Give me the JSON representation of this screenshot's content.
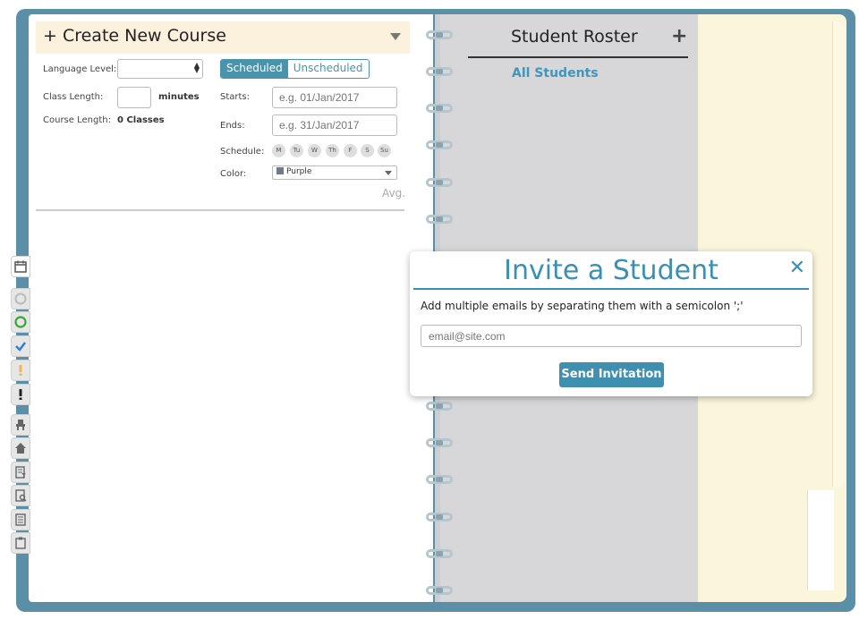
{
  "course": {
    "header_title": "+ Create New Course",
    "language_level_label": "Language Level:",
    "class_length_label": "Class Length:",
    "class_length_unit": "minutes",
    "course_length_label": "Course Length:",
    "course_length_value": "0 Classes",
    "toggle": {
      "scheduled": "Scheduled",
      "unscheduled": "Unscheduled",
      "selected": "Scheduled"
    },
    "starts_label": "Starts:",
    "starts_placeholder": "e.g. 01/Jan/2017",
    "ends_label": "Ends:",
    "ends_placeholder": "e.g. 31/Jan/2017",
    "schedule_label": "Schedule:",
    "days": [
      "M",
      "Tu",
      "W",
      "Th",
      "F",
      "S",
      "Su"
    ],
    "color_label": "Color:",
    "color_value": "Purple",
    "avg_label": "Avg."
  },
  "roster": {
    "title": "Student Roster",
    "add_symbol": "+",
    "all_students": "All Students"
  },
  "modal": {
    "title": "Invite a Student",
    "close_symbol": "✕",
    "instructions": "Add multiple emails by separating them with a semicolon ';'",
    "email_placeholder": "email@site.com",
    "send_label": "Send Invitation"
  },
  "side_tabs": [
    "calendar-icon",
    "circle-grey-icon",
    "circle-green-icon",
    "checkmark-icon",
    "exclamation-orange-icon",
    "exclamation-black-icon",
    "chair-icon",
    "home-icon",
    "document-filter-icon",
    "document-search-icon",
    "document-list-icon",
    "clipboard-icon"
  ],
  "colors": {
    "accent": "#3a90b4",
    "binder": "#5b8fa8",
    "header_bg": "#fcf1dc",
    "roster_bg": "#d7d7d9",
    "yellow_page": "#fbf5dc",
    "swatch_purple": "#6f7b8a"
  }
}
